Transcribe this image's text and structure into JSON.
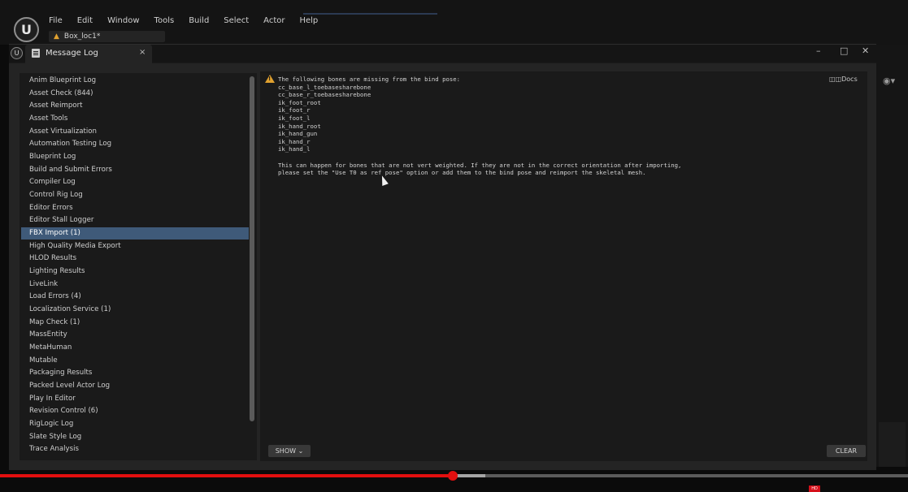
{
  "app": {
    "logo_text": "U",
    "menu": [
      "File",
      "Edit",
      "Window",
      "Tools",
      "Build",
      "Select",
      "Actor",
      "Help"
    ],
    "level_tab": "Box_loc1*"
  },
  "window": {
    "tab_label": "Message Log",
    "tab_close": "×",
    "minimize": "–",
    "maximize": "□",
    "close": "✕"
  },
  "categories": [
    "Anim Blueprint Log",
    "Asset Check (844)",
    "Asset Reimport",
    "Asset Tools",
    "Asset Virtualization",
    "Automation Testing Log",
    "Blueprint Log",
    "Build and Submit Errors",
    "Compiler Log",
    "Control Rig Log",
    "Editor Errors",
    "Editor Stall Logger",
    "FBX Import (1)",
    "High Quality Media Export",
    "HLOD Results",
    "Lighting Results",
    "LiveLink",
    "Load Errors (4)",
    "Localization Service (1)",
    "Map Check (1)",
    "MassEntity",
    "MetaHuman",
    "Mutable",
    "Packaging Results",
    "Packed Level Actor Log",
    "Play In Editor",
    "Revision Control (6)",
    "RigLogic Log",
    "Slate Style Log",
    "Trace Analysis"
  ],
  "selected_category": "FBX Import (1)",
  "message": {
    "lines": [
      "The following bones are missing from the bind pose:",
      "cc_base_l_toebasesharebone",
      "cc_base_r_toebasesharebone",
      "ik_foot_root",
      "ik_foot_r",
      "ik_foot_l",
      "ik_hand_root",
      "ik_hand_gun",
      "ik_hand_r",
      "ik_hand_l",
      "",
      "This can happen for bones that are not vert weighted. If they are not in the correct orientation after importing,",
      "please set the \"Use T0 as ref pose\" option or add them to the bind pose and reimport the skeletal mesh."
    ]
  },
  "buttons": {
    "docs": "Docs",
    "show": "SHOW",
    "clear": "CLEAR"
  },
  "video": {
    "progress": 0.5
  },
  "colors": {
    "selection": "#3f5a79",
    "warning": "#e0a12f",
    "video_played": "#e20f0f"
  }
}
